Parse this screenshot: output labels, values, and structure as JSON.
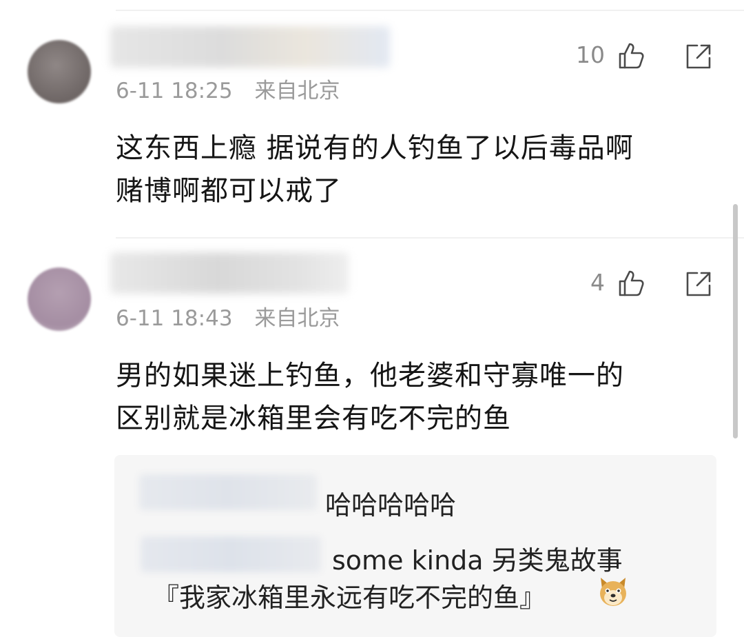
{
  "comments": [
    {
      "time": "6-11 18:25",
      "location": "来自北京",
      "likes": "10",
      "text_lines": [
        "这东西上瘾 据说有的人钓鱼了以后毒品啊",
        "赌博啊都可以戒了"
      ]
    },
    {
      "time": "6-11 18:43",
      "location": "来自北京",
      "likes": "4",
      "text_lines": [
        "男的如果迷上钓鱼，他老婆和守寡唯一的",
        "区别就是冰箱里会有吃不完的鱼"
      ],
      "replies": [
        {
          "text": "哈哈哈哈哈"
        },
        {
          "text": "some kinda 另类鬼故事",
          "text2": "『我家冰箱里永远有吃不完的鱼』"
        }
      ]
    }
  ],
  "icons": {
    "like": "thumbs-up-icon",
    "share": "share-icon",
    "emoji": "doge-emoji-icon"
  },
  "colors": {
    "meta_text": "#9a9a9a",
    "reply_bg": "#f6f6f6"
  }
}
